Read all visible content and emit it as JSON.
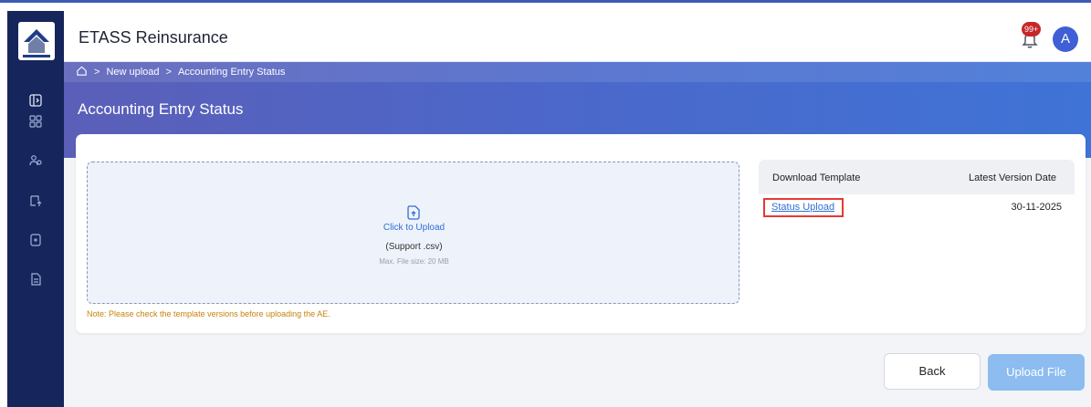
{
  "colors": {
    "sidebar": "#16255b",
    "banner_start": "#5b5fb8",
    "banner_end": "#3f73d6",
    "accent": "#2f6fd6",
    "note": "#c8820a",
    "highlight": "#e53935",
    "upload_button": "#8cbcf0",
    "badge": "#c62828",
    "avatar": "#3f5fd6"
  },
  "sidebar": {
    "logo": "company-logo",
    "items": [
      {
        "icon": "panel-toggle-icon"
      },
      {
        "icon": "grid-icon"
      },
      {
        "icon": "users-icon"
      },
      {
        "icon": "upload-tray-icon"
      },
      {
        "icon": "add-file-icon"
      },
      {
        "icon": "document-icon"
      }
    ]
  },
  "header": {
    "title": "ETASS Reinsurance",
    "notification_count": "99+",
    "avatar_initial": "A"
  },
  "breadcrumb": {
    "items": [
      "New upload",
      "Accounting Entry Status"
    ]
  },
  "page": {
    "title": "Accounting Entry Status"
  },
  "upload": {
    "click_label": "Click to Upload",
    "support": "(Support .csv)",
    "max_size": "Max. File size: 20 MB",
    "note": "Note: Please check the template versions before uploading the AE."
  },
  "template_table": {
    "headers": [
      "Download Template",
      "Latest Version Date"
    ],
    "rows": [
      {
        "name": "Status Upload",
        "date": "30-11-2025"
      }
    ]
  },
  "actions": {
    "back": "Back",
    "upload": "Upload File"
  }
}
